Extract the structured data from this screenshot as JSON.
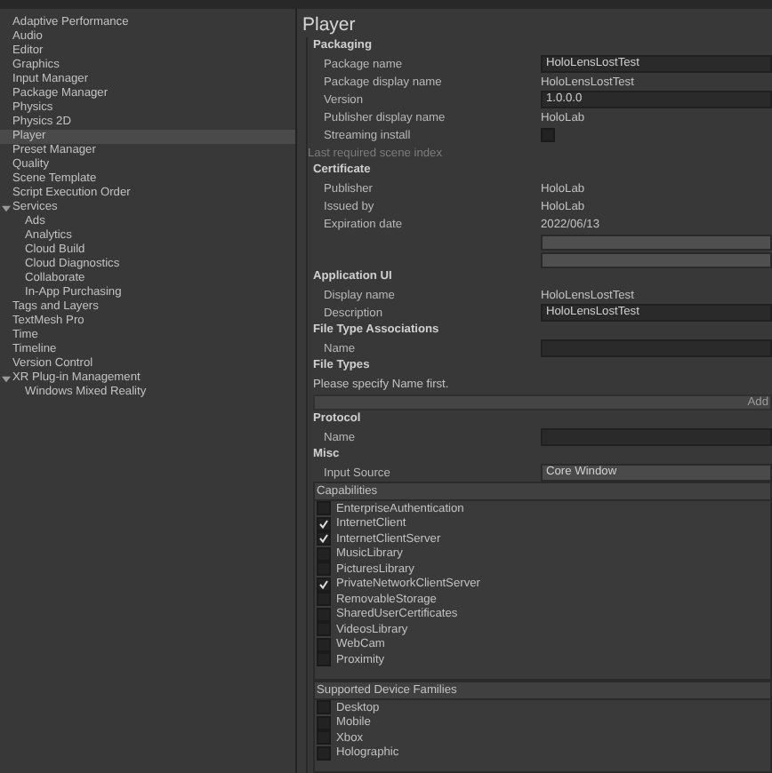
{
  "sidebar": {
    "items": [
      {
        "label": "Adaptive Performance",
        "selected": false
      },
      {
        "label": "Audio",
        "selected": false
      },
      {
        "label": "Editor",
        "selected": false
      },
      {
        "label": "Graphics",
        "selected": false
      },
      {
        "label": "Input Manager",
        "selected": false
      },
      {
        "label": "Package Manager",
        "selected": false
      },
      {
        "label": "Physics",
        "selected": false
      },
      {
        "label": "Physics 2D",
        "selected": false
      },
      {
        "label": "Player",
        "selected": true
      },
      {
        "label": "Preset Manager",
        "selected": false
      },
      {
        "label": "Quality",
        "selected": false
      },
      {
        "label": "Scene Template",
        "selected": false
      },
      {
        "label": "Script Execution Order",
        "selected": false
      },
      {
        "label": "Services",
        "selected": false,
        "expanded": true,
        "children": [
          {
            "label": "Ads",
            "selected": false
          },
          {
            "label": "Analytics",
            "selected": false
          },
          {
            "label": "Cloud Build",
            "selected": false
          },
          {
            "label": "Cloud Diagnostics",
            "selected": false
          },
          {
            "label": "Collaborate",
            "selected": false
          },
          {
            "label": "In-App Purchasing",
            "selected": false
          }
        ]
      },
      {
        "label": "Tags and Layers",
        "selected": false
      },
      {
        "label": "TextMesh Pro",
        "selected": false
      },
      {
        "label": "Time",
        "selected": false
      },
      {
        "label": "Timeline",
        "selected": false
      },
      {
        "label": "Version Control",
        "selected": false
      },
      {
        "label": "XR Plug-in Management",
        "selected": false,
        "expanded": true,
        "children": [
          {
            "label": "Windows Mixed Reality",
            "selected": false
          }
        ]
      }
    ]
  },
  "title": "Player",
  "sections": [
    {
      "title": "Packaging",
      "rows": [
        {
          "kind": "field",
          "label": "Package name",
          "value": "HoloLensLostTest"
        },
        {
          "kind": "text",
          "label": "Package display name",
          "value": "HoloLensLostTest"
        },
        {
          "kind": "field",
          "label": "Version",
          "value": "1.0.0.0"
        },
        {
          "kind": "text",
          "label": "Publisher display name",
          "value": "HoloLab"
        },
        {
          "kind": "checkbox",
          "label": "Streaming install",
          "checked": false
        },
        {
          "kind": "note",
          "label": "Last required scene index",
          "disabled": true
        }
      ]
    },
    {
      "title": "Certificate",
      "rows": [
        {
          "kind": "text",
          "label": "Publisher",
          "value": "HoloLab"
        },
        {
          "kind": "text",
          "label": "Issued by",
          "value": "HoloLab"
        },
        {
          "kind": "text",
          "label": "Expiration date",
          "value": "2022/06/13"
        },
        {
          "kind": "blank"
        },
        {
          "kind": "blank"
        }
      ]
    },
    {
      "title": "Application UI",
      "rows": [
        {
          "kind": "text",
          "label": "Display name",
          "value": "HoloLensLostTest"
        },
        {
          "kind": "field",
          "label": "Description",
          "value": "HoloLensLostTest"
        }
      ]
    },
    {
      "title": "File Type Associations",
      "rows": [
        {
          "kind": "field",
          "label": "Name"
        }
      ]
    },
    {
      "title": "File Types",
      "rows": [
        {
          "kind": "note",
          "label": "Please specify Name first.",
          "disabled": false
        },
        {
          "kind": "add-bar",
          "button": "Add"
        }
      ]
    },
    {
      "title": "Protocol",
      "rows": [
        {
          "kind": "field",
          "label": "Name"
        }
      ]
    },
    {
      "title": "Misc",
      "rows": [
        {
          "kind": "dropdown",
          "label": "Input Source",
          "value": "Core Window"
        }
      ]
    },
    {
      "title": "Capabilities",
      "kind": "checklist",
      "items": [
        {
          "label": "EnterpriseAuthentication",
          "checked": false
        },
        {
          "label": "InternetClient",
          "checked": true
        },
        {
          "label": "InternetClientServer",
          "checked": true
        },
        {
          "label": "MusicLibrary",
          "checked": false
        },
        {
          "label": "PicturesLibrary",
          "checked": false
        },
        {
          "label": "PrivateNetworkClientServer",
          "checked": true
        },
        {
          "label": "RemovableStorage",
          "checked": false
        },
        {
          "label": "SharedUserCertificates",
          "checked": false
        },
        {
          "label": "VideosLibrary",
          "checked": false
        },
        {
          "label": "WebCam",
          "checked": false
        },
        {
          "label": "Proximity",
          "checked": false
        }
      ]
    },
    {
      "title": "Supported Device Families",
      "kind": "checklist",
      "items": [
        {
          "label": "Desktop",
          "checked": false
        },
        {
          "label": "Mobile",
          "checked": false
        },
        {
          "label": "Xbox",
          "checked": false
        },
        {
          "label": "Holographic",
          "checked": false
        }
      ]
    }
  ]
}
